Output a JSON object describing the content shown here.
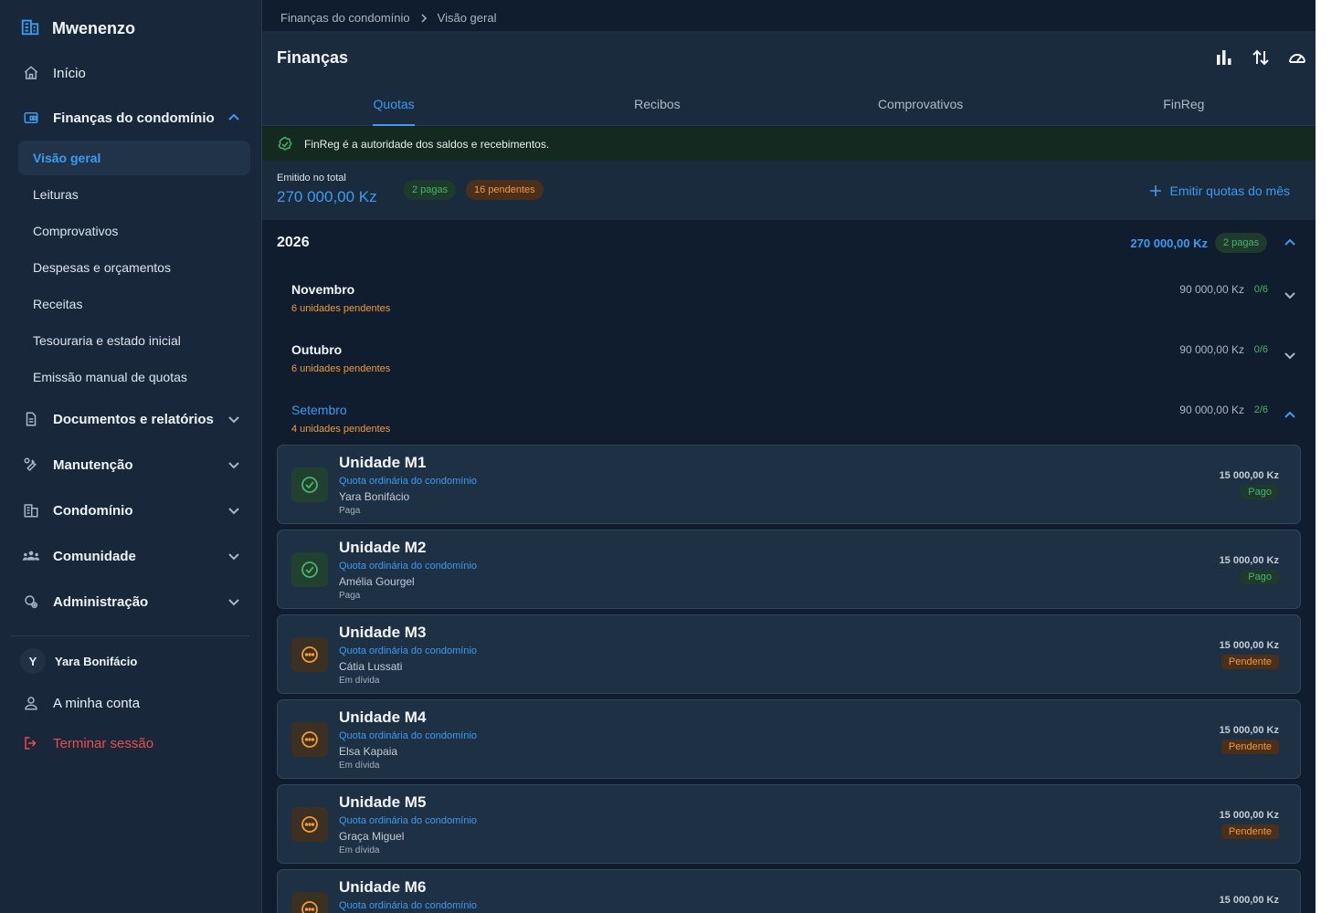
{
  "brand": {
    "name": "Mwenenzo"
  },
  "sidebar": {
    "home": "Início",
    "finance": {
      "label": "Finanças do condomínio",
      "items": [
        "Visão geral",
        "Leituras",
        "Comprovativos",
        "Despesas e orçamentos",
        "Receitas",
        "Tesouraria e estado inicial",
        "Emissão manual de quotas"
      ]
    },
    "sections": [
      "Documentos e relatórios",
      "Manutenção",
      "Condomínio",
      "Comunidade",
      "Administração"
    ],
    "user": {
      "initial": "Y",
      "name": "Yara Bonifácio"
    },
    "account": "A minha conta",
    "logout": "Terminar sessão"
  },
  "breadcrumb": [
    "Finanças do condomínio",
    "Visão geral"
  ],
  "header": {
    "title": "Finanças",
    "tabs": [
      "Quotas",
      "Recibos",
      "Comprovativos",
      "FinReg"
    ]
  },
  "notice": "FinReg é a autoridade dos saldos e recebimentos.",
  "summary": {
    "label": "Emitido no total",
    "value": "270 000,00 Kz",
    "paid": "2 pagas",
    "pending": "16 pendentes",
    "action": "Emitir quotas do mês"
  },
  "year": {
    "label": "2026",
    "amount": "270 000,00 Kz",
    "paid": "2 pagas"
  },
  "months": [
    {
      "name": "Novembro",
      "pending": "6 unidades pendentes",
      "amount": "90 000,00 Kz",
      "ratio": "0/6"
    },
    {
      "name": "Outubro",
      "pending": "6 unidades pendentes",
      "amount": "90 000,00 Kz",
      "ratio": "0/6"
    },
    {
      "name": "Setembro",
      "pending": "4 unidades pendentes",
      "amount": "90 000,00 Kz",
      "ratio": "2/6"
    }
  ],
  "units": [
    {
      "title": "Unidade M1",
      "sub": "Quota ordinária do condomínio",
      "owner": "Yara Bonifácio",
      "state": "Paga",
      "amount": "15 000,00 Kz",
      "badge": "Pago"
    },
    {
      "title": "Unidade M2",
      "sub": "Quota ordinária do condomínio",
      "owner": "Amélia Gourgel",
      "state": "Paga",
      "amount": "15 000,00 Kz",
      "badge": "Pago"
    },
    {
      "title": "Unidade M3",
      "sub": "Quota ordinária do condomínio",
      "owner": "Cátia Lussati",
      "state": "Em dívida",
      "amount": "15 000,00 Kz",
      "badge": "Pendente"
    },
    {
      "title": "Unidade M4",
      "sub": "Quota ordinária do condomínio",
      "owner": "Elsa Kapaia",
      "state": "Em dívida",
      "amount": "15 000,00 Kz",
      "badge": "Pendente"
    },
    {
      "title": "Unidade M5",
      "sub": "Quota ordinária do condomínio",
      "owner": "Graça Miguel",
      "state": "Em dívida",
      "amount": "15 000,00 Kz",
      "badge": "Pendente"
    },
    {
      "title": "Unidade M6",
      "sub": "Quota ordinária do condomínio",
      "amount": "15 000,00 Kz"
    }
  ],
  "colors": {
    "accent": "#3d9bf0",
    "paid": "#4ab36a",
    "pending": "#f29a38",
    "danger": "#ef4b4b"
  }
}
